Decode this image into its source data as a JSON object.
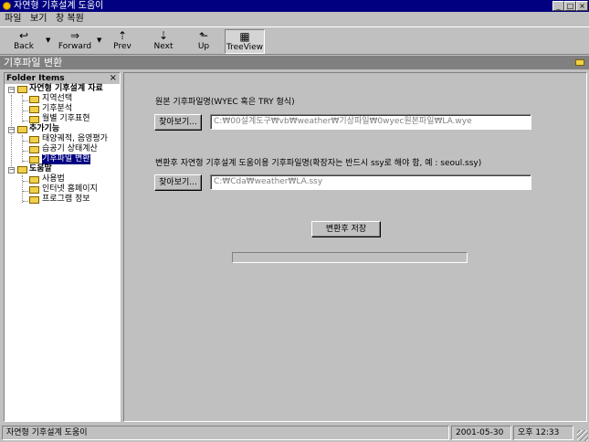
{
  "window": {
    "title": "자연형 기후설계 도움이",
    "app_icon": "sun-icon",
    "controls": {
      "minimize": "_",
      "maximize": "□",
      "close": "×"
    }
  },
  "menu": [
    "파일",
    "보기",
    "창 복원"
  ],
  "toolbar": {
    "buttons": [
      {
        "label": "Back",
        "icon": "↩"
      },
      {
        "label": "Forward",
        "icon": "⇒"
      },
      {
        "label": "Prev",
        "icon": "⇡"
      },
      {
        "label": "Next",
        "icon": "⇣"
      },
      {
        "label": "Up",
        "icon": "⬑"
      },
      {
        "label": "TreeView",
        "icon": "▦"
      }
    ]
  },
  "header": {
    "title": "기후파일 변환",
    "icon": "folder-icon"
  },
  "tree": {
    "header": "Folder Items",
    "close": "×",
    "nodes": [
      {
        "label": "자연형 기후설계 자료"
      },
      {
        "label": "지역선택"
      },
      {
        "label": "기후분석"
      },
      {
        "label": "월별 기후표현"
      },
      {
        "label": "추가기능"
      },
      {
        "label": "태양궤적, 음영평가"
      },
      {
        "label": "습공기 상태계산"
      },
      {
        "label": "기후파일 변환"
      },
      {
        "label": "도움말"
      },
      {
        "label": "사용법"
      },
      {
        "label": "인터넷 홈페이지"
      },
      {
        "label": "프로그램 정보"
      }
    ]
  },
  "main": {
    "source_label": "원본 기후파일명(WYEC 혹은 TRY 형식)",
    "source_browse": "찾아보기...",
    "source_path": "C:₩00설계도구₩vb₩weather₩기상파일₩0wyec원본파일₩LA.wye",
    "target_label": "변환후 자연형 기후설계 도움이용 기후파일명(확장자는 반드시 ssy로 해야 함, 예 : seoul.ssy)",
    "target_browse": "찾아보기...",
    "target_path": "C:₩Cda₩weather₩LA.ssy",
    "save_button": "변환후 저장",
    "progress": 0
  },
  "status": {
    "text": "자연형 기후설계 도움이",
    "date": "2001-05-30",
    "time": "오후 12:33"
  }
}
